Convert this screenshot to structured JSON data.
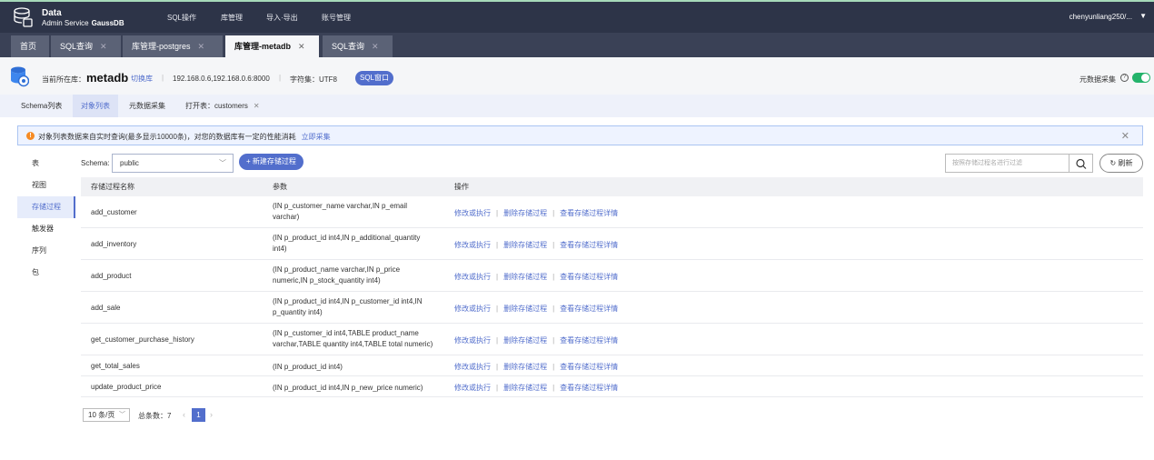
{
  "header": {
    "brand_line1": "Data",
    "brand_line2": "Admin Service",
    "brand_product": "GaussDB",
    "menu": [
      "SQL操作",
      "库管理",
      "导入·导出",
      "账号管理"
    ],
    "user": "chenyunliang250/..."
  },
  "tabs": [
    {
      "label": "首页",
      "closable": false
    },
    {
      "label": "SQL查询",
      "closable": true
    },
    {
      "label": "库管理-postgres",
      "closable": true
    },
    {
      "label": "库管理-metadb",
      "closable": true,
      "active": true
    },
    {
      "label": "SQL查询",
      "closable": true
    }
  ],
  "dbinfo": {
    "current_db_label": "当前所在库：",
    "db_name": "metadb",
    "switch_label": "切换库",
    "host": "192.168.0.6,192.168.0.6:8000",
    "charset": "字符集：UTF8",
    "sql_window": "SQL窗口",
    "meta_collect": "元数据采集",
    "meta_collect_on": true
  },
  "subtabs": [
    "Schema列表",
    "对象列表",
    "元数据采集",
    "打开表：customers"
  ],
  "notice": {
    "text": "对象列表数据来自实时查询(最多显示10000条)，对您的数据库有一定的性能消耗",
    "link": "立即采集"
  },
  "leftnav": [
    "表",
    "视图",
    "存储过程",
    "触发器",
    "序列",
    "包"
  ],
  "toolbar": {
    "schema_label": "Schema:",
    "schema_value": "public",
    "new_button": "+ 新建存储过程",
    "filter_placeholder": "按照存储过程名进行过滤",
    "refresh": "刷新"
  },
  "table": {
    "columns": [
      "存储过程名称",
      "参数",
      "操作"
    ],
    "ops": [
      "修改或执行",
      "删除存储过程",
      "查看存储过程详情"
    ],
    "rows": [
      {
        "name": "add_customer",
        "params": "(IN p_customer_name varchar,IN p_email varchar)"
      },
      {
        "name": "add_inventory",
        "params": "(IN p_product_id int4,IN p_additional_quantity int4)"
      },
      {
        "name": "add_product",
        "params": "(IN p_product_name varchar,IN p_price numeric,IN p_stock_quantity int4)"
      },
      {
        "name": "add_sale",
        "params": "(IN p_product_id int4,IN p_customer_id int4,IN p_quantity int4)"
      },
      {
        "name": "get_customer_purchase_history",
        "params": "(IN p_customer_id int4,TABLE product_name varchar,TABLE quantity int4,TABLE total numeric)"
      },
      {
        "name": "get_total_sales",
        "params": "(IN p_product_id int4)"
      },
      {
        "name": "update_product_price",
        "params": "(IN p_product_id int4,IN p_new_price numeric)"
      }
    ]
  },
  "pagination": {
    "page_size": "10 条/页",
    "total": "总条数：7",
    "current": "1"
  }
}
